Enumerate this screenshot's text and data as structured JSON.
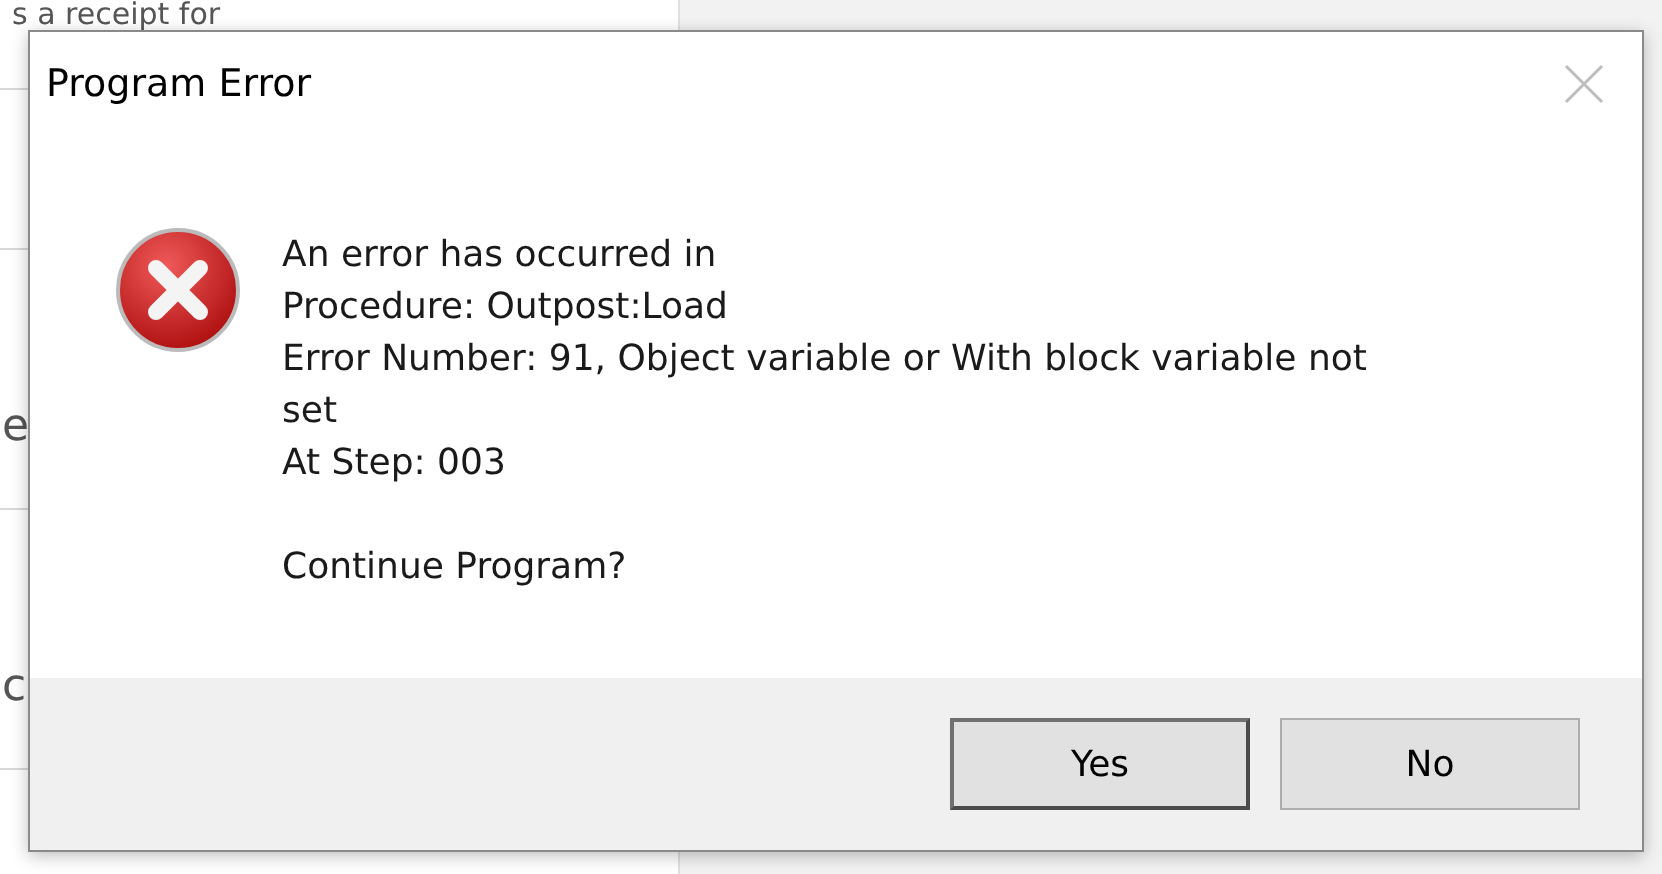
{
  "background": {
    "texts": [
      "s a receipt for",
      "e",
      "c"
    ]
  },
  "dialog": {
    "title": "Program Error",
    "message_lines": [
      "An error has occurred in",
      "Procedure: Outpost:Load",
      "Error Number: 91, Object variable or With block variable not",
      "set",
      "At Step: 003"
    ],
    "prompt": "Continue Program?",
    "buttons": [
      {
        "label": "Yes",
        "selected": true
      },
      {
        "label": "No",
        "selected": false
      }
    ]
  }
}
